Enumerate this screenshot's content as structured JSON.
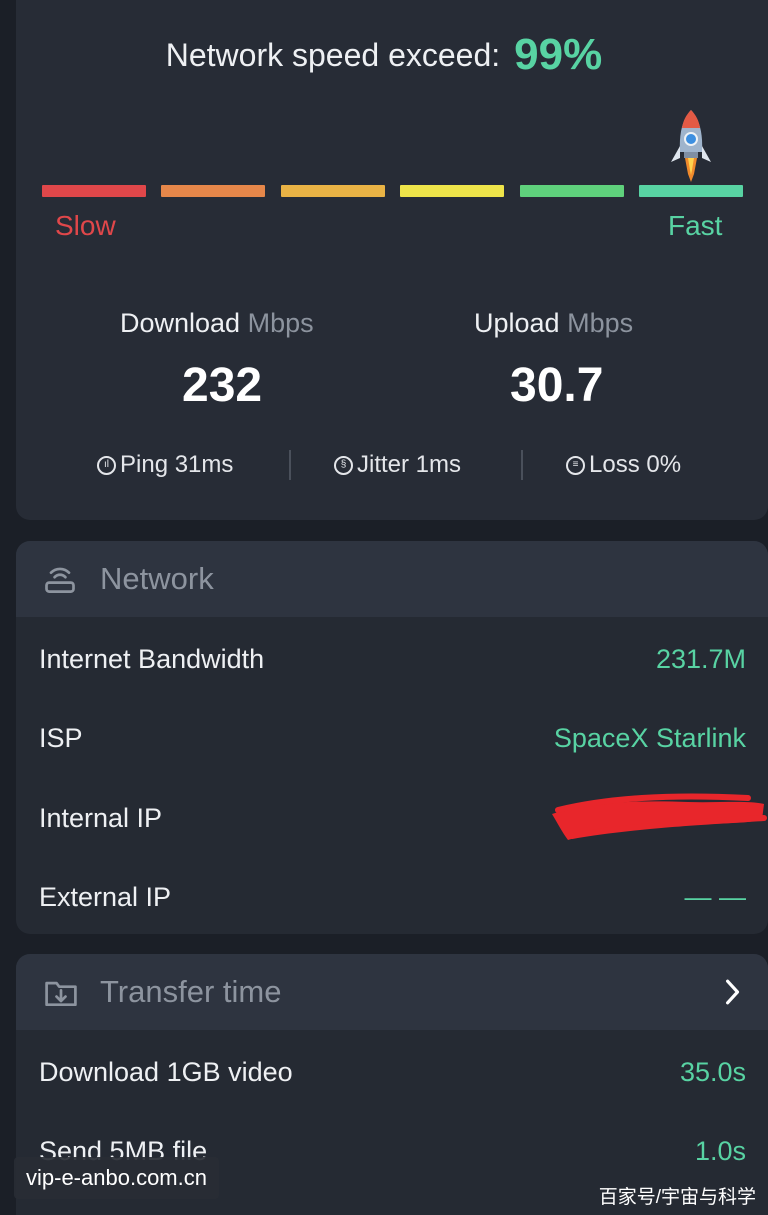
{
  "speed_result": {
    "exceed_label": "Network speed exceed:",
    "exceed_percent": "99%",
    "scale": {
      "slow_label": "Slow",
      "fast_label": "Fast",
      "segment_colors": [
        "#e0474a",
        "#e6874a",
        "#e9b345",
        "#eee44a",
        "#5fd17c",
        "#58d3a3"
      ],
      "position_fraction": 0.99,
      "marker_icon": "rocket-icon"
    },
    "download": {
      "label": "Download",
      "unit": "Mbps",
      "value": "232"
    },
    "upload": {
      "label": "Upload",
      "unit": "Mbps",
      "value": "30.7"
    },
    "stats": {
      "ping": {
        "icon": "ping-icon",
        "text": "Ping 31ms"
      },
      "jitter": {
        "icon": "jitter-icon",
        "text": "Jitter 1ms"
      },
      "loss": {
        "icon": "loss-icon",
        "text": "Loss 0%"
      }
    }
  },
  "network": {
    "icon": "router-icon",
    "title": "Network",
    "rows": [
      {
        "label": "Internet Bandwidth",
        "value": "231.7M"
      },
      {
        "label": "ISP",
        "value": "SpaceX Starlink"
      },
      {
        "label": "Internal IP",
        "value": ""
      },
      {
        "label": "External IP",
        "value": "— —"
      }
    ]
  },
  "transfer_time": {
    "icon": "folder-download-icon",
    "title": "Transfer time",
    "chevron_icon": "chevron-right-icon",
    "rows": [
      {
        "label": "Download 1GB video",
        "value": "35.0s"
      },
      {
        "label": "Send 5MB file",
        "value": "1.0s"
      }
    ]
  },
  "watermarks": {
    "left": "vip-e-anbo.com.cn",
    "right": "百家号/宇宙与科学"
  },
  "colors": {
    "accent": "#58d3a3",
    "slow": "#e0474a",
    "redaction": "#e8262b"
  }
}
